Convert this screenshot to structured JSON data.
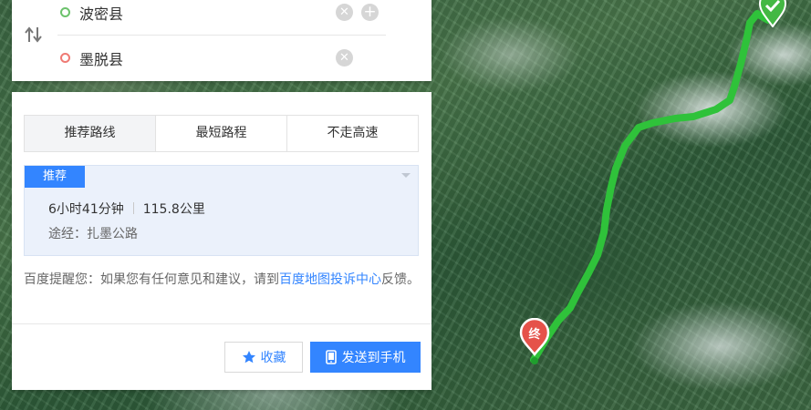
{
  "search": {
    "start": "波密县",
    "end": "墨脱县"
  },
  "tabs": [
    {
      "label": "推荐路线",
      "active": true
    },
    {
      "label": "最短路程",
      "active": false
    },
    {
      "label": "不走高速",
      "active": false
    }
  ],
  "plan": {
    "badge": "推荐",
    "duration": "6小时41分钟",
    "distance": "115.8公里",
    "via": "途经：扎墨公路"
  },
  "notice": {
    "prefix": "百度提醒您：如果您有任何意见和建议，请到",
    "link": "百度地图投诉中心",
    "suffix": "反馈。"
  },
  "buttons": {
    "favorite": "收藏",
    "send_to_phone": "发送到手机"
  },
  "map": {
    "end_marker_label": "终",
    "route_color": "#2fc23a",
    "accent": "#3385ff",
    "end_marker_color": "#e5524a"
  },
  "icons": [
    "swap-icon",
    "clear-icon",
    "add-icon",
    "star-icon",
    "phone-icon",
    "end-marker-icon",
    "start-marker-icon"
  ]
}
